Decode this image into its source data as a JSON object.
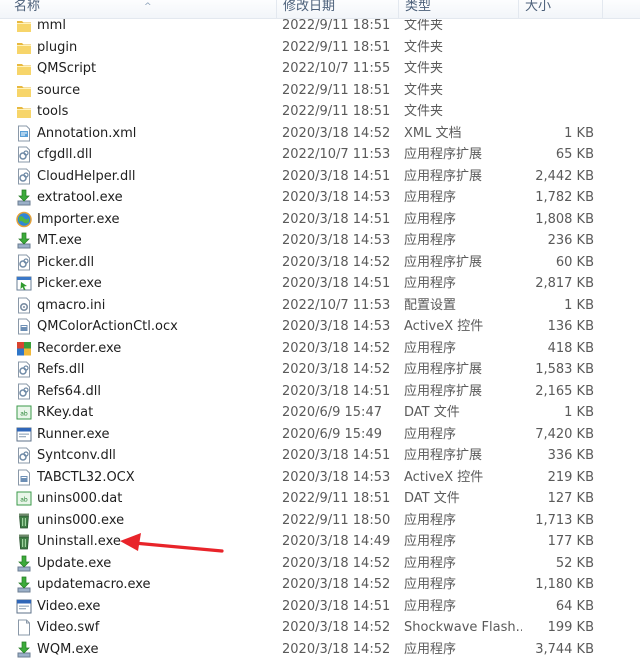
{
  "columns": {
    "name": "名称",
    "modified": "修改日期",
    "type": "类型",
    "size": "大小"
  },
  "files": [
    {
      "name": "mml",
      "modified": "2022/9/11 18:51",
      "type": "文件夹",
      "size": "",
      "icon": "folder-icon"
    },
    {
      "name": "plugin",
      "modified": "2022/9/11 18:51",
      "type": "文件夹",
      "size": "",
      "icon": "folder-icon"
    },
    {
      "name": "QMScript",
      "modified": "2022/10/7 11:55",
      "type": "文件夹",
      "size": "",
      "icon": "folder-icon"
    },
    {
      "name": "source",
      "modified": "2022/9/11 18:51",
      "type": "文件夹",
      "size": "",
      "icon": "folder-icon"
    },
    {
      "name": "tools",
      "modified": "2022/9/11 18:51",
      "type": "文件夹",
      "size": "",
      "icon": "folder-icon"
    },
    {
      "name": "Annotation.xml",
      "modified": "2020/3/18 14:52",
      "type": "XML 文档",
      "size": "1 KB",
      "icon": "xml-file-icon"
    },
    {
      "name": "cfgdll.dll",
      "modified": "2022/10/7 11:53",
      "type": "应用程序扩展",
      "size": "65 KB",
      "icon": "dll-file-icon"
    },
    {
      "name": "CloudHelper.dll",
      "modified": "2020/3/18 14:51",
      "type": "应用程序扩展",
      "size": "2,442 KB",
      "icon": "dll-file-icon"
    },
    {
      "name": "extratool.exe",
      "modified": "2020/3/18 14:53",
      "type": "应用程序",
      "size": "1,782 KB",
      "icon": "install-arrow-icon"
    },
    {
      "name": "Importer.exe",
      "modified": "2020/3/18 14:51",
      "type": "应用程序",
      "size": "1,808 KB",
      "icon": "globe-app-icon"
    },
    {
      "name": "MT.exe",
      "modified": "2020/3/18 14:53",
      "type": "应用程序",
      "size": "236 KB",
      "icon": "install-arrow-icon"
    },
    {
      "name": "Picker.dll",
      "modified": "2020/3/18 14:52",
      "type": "应用程序扩展",
      "size": "60 KB",
      "icon": "dll-file-icon"
    },
    {
      "name": "Picker.exe",
      "modified": "2020/3/18 14:51",
      "type": "应用程序",
      "size": "2,817 KB",
      "icon": "picker-app-icon"
    },
    {
      "name": "qmacro.ini",
      "modified": "2022/10/7 11:53",
      "type": "配置设置",
      "size": "1 KB",
      "icon": "ini-file-icon"
    },
    {
      "name": "QMColorActionCtl.ocx",
      "modified": "2020/3/18 14:53",
      "type": "ActiveX 控件",
      "size": "136 KB",
      "icon": "ocx-file-icon"
    },
    {
      "name": "Recorder.exe",
      "modified": "2020/3/18 14:52",
      "type": "应用程序",
      "size": "418 KB",
      "icon": "recorder-app-icon"
    },
    {
      "name": "Refs.dll",
      "modified": "2020/3/18 14:52",
      "type": "应用程序扩展",
      "size": "1,583 KB",
      "icon": "dll-file-icon"
    },
    {
      "name": "Refs64.dll",
      "modified": "2020/3/18 14:51",
      "type": "应用程序扩展",
      "size": "2,165 KB",
      "icon": "dll-file-icon"
    },
    {
      "name": "RKey.dat",
      "modified": "2020/6/9 15:47",
      "type": "DAT 文件",
      "size": "1 KB",
      "icon": "dat-file-icon"
    },
    {
      "name": "Runner.exe",
      "modified": "2020/6/9 15:49",
      "type": "应用程序",
      "size": "7,420 KB",
      "icon": "window-app-icon"
    },
    {
      "name": "Syntconv.dll",
      "modified": "2020/3/18 14:51",
      "type": "应用程序扩展",
      "size": "336 KB",
      "icon": "dll-file-icon"
    },
    {
      "name": "TABCTL32.OCX",
      "modified": "2020/3/18 14:53",
      "type": "ActiveX 控件",
      "size": "219 KB",
      "icon": "ocx-file-icon"
    },
    {
      "name": "unins000.dat",
      "modified": "2022/9/11 18:51",
      "type": "DAT 文件",
      "size": "127 KB",
      "icon": "dat-file-icon"
    },
    {
      "name": "unins000.exe",
      "modified": "2022/9/11 18:50",
      "type": "应用程序",
      "size": "1,713 KB",
      "icon": "trash-app-icon"
    },
    {
      "name": "Uninstall.exe",
      "modified": "2020/3/18 14:49",
      "type": "应用程序",
      "size": "177 KB",
      "icon": "trash-app-icon"
    },
    {
      "name": "Update.exe",
      "modified": "2020/3/18 14:52",
      "type": "应用程序",
      "size": "52 KB",
      "icon": "install-arrow-icon"
    },
    {
      "name": "updatemacro.exe",
      "modified": "2020/3/18 14:52",
      "type": "应用程序",
      "size": "1,180 KB",
      "icon": "install-arrow-icon"
    },
    {
      "name": "Video.exe",
      "modified": "2020/3/18 14:51",
      "type": "应用程序",
      "size": "64 KB",
      "icon": "window-app-icon"
    },
    {
      "name": "Video.swf",
      "modified": "2020/3/18 14:52",
      "type": "Shockwave Flash...",
      "size": "199 KB",
      "icon": "blank-file-icon"
    },
    {
      "name": "WQM.exe",
      "modified": "2020/3/18 14:52",
      "type": "应用程序",
      "size": "3,744 KB",
      "icon": "install-arrow-icon"
    }
  ],
  "annotation": {
    "color": "#e8242a",
    "points_to": "Uninstall.exe"
  }
}
